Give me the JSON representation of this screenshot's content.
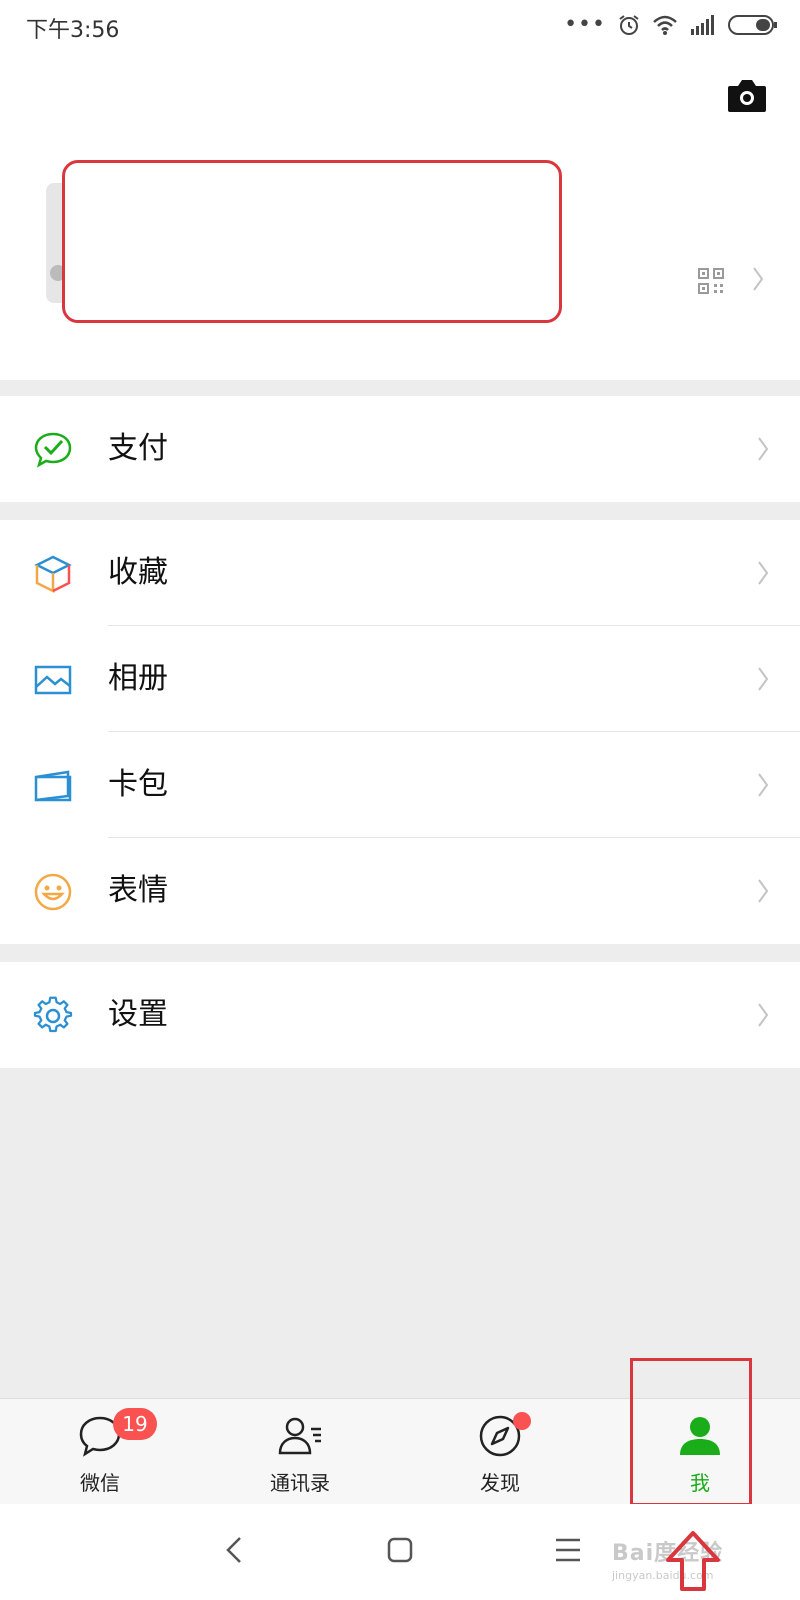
{
  "status_bar": {
    "time": "下午3:56",
    "icons": [
      "more-dots-icon",
      "alarm-icon",
      "wifi-icon",
      "signal-icon",
      "battery-icon"
    ]
  },
  "header": {
    "camera_icon": "camera-icon",
    "qr_icon": "qr-code-icon"
  },
  "menu": {
    "pay": {
      "label": "支付",
      "icon": "wechat-pay-icon",
      "color": "#1aad19"
    },
    "favorites": {
      "label": "收藏",
      "icon": "favorites-cube-icon"
    },
    "album": {
      "label": "相册",
      "icon": "album-icon",
      "color": "#2b8fd4"
    },
    "cards": {
      "label": "卡包",
      "icon": "card-wallet-icon",
      "color": "#2b8fd4"
    },
    "stickers": {
      "label": "表情",
      "icon": "smiley-icon",
      "color": "#f3a845"
    },
    "settings": {
      "label": "设置",
      "icon": "gear-icon",
      "color": "#2b8fd4"
    }
  },
  "tabbar": {
    "tabs": [
      {
        "label": "微信",
        "icon": "chat-bubble-icon",
        "badge": "19"
      },
      {
        "label": "通讯录",
        "icon": "contacts-icon"
      },
      {
        "label": "发现",
        "icon": "compass-icon",
        "dot": true
      },
      {
        "label": "我",
        "icon": "person-icon",
        "active": true
      }
    ],
    "active_color": "#1aad19"
  },
  "navbar": {
    "buttons": [
      "back-icon",
      "home-icon",
      "menu-icon"
    ]
  },
  "watermark": {
    "main": "Bai度经验",
    "sub": "jingyan.baidu.com"
  },
  "annotation_color": "#d9363e"
}
